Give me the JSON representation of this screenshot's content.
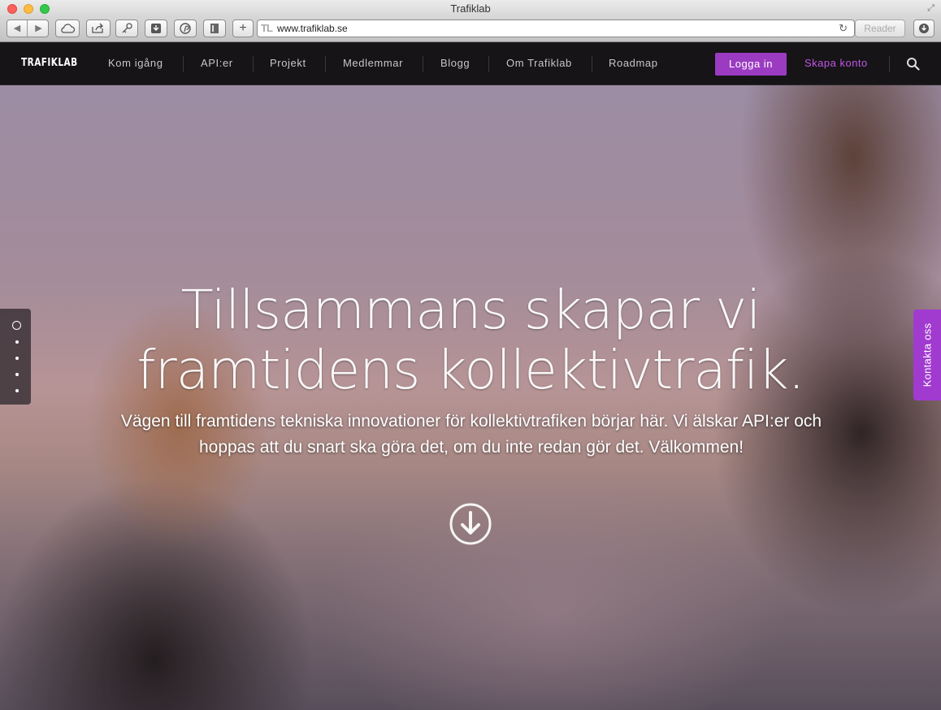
{
  "window": {
    "title": "Trafiklab"
  },
  "browser": {
    "url": "www.trafiklab.se",
    "reader_label": "Reader",
    "site_icon_text": "TL"
  },
  "nav": {
    "brand": "TRAFIKLAB",
    "items": [
      "Kom igång",
      "API:er",
      "Projekt",
      "Medlemmar",
      "Blogg",
      "Om Trafiklab",
      "Roadmap"
    ],
    "login_label": "Logga in",
    "signup_label": "Skapa konto"
  },
  "hero": {
    "headline_line1": "Tillsammans skapar vi",
    "headline_line2": "framtidens kollektivtrafik.",
    "sub_line1": "Vägen till framtidens tekniska innovationer för kollektivtrafiken börjar här. Vi älskar API:er och",
    "sub_line2": "hoppas att du snart ska göra det, om du inte redan gör det. Välkommen!"
  },
  "slider": {
    "active_index": 0,
    "count": 5
  },
  "contact_tab": {
    "label": "Kontakta oss"
  },
  "colors": {
    "nav_bg": "#161416",
    "accent_purple": "#9b3bc2",
    "signup_purple": "#c256e6",
    "contact_tab": "#a13bd0"
  }
}
